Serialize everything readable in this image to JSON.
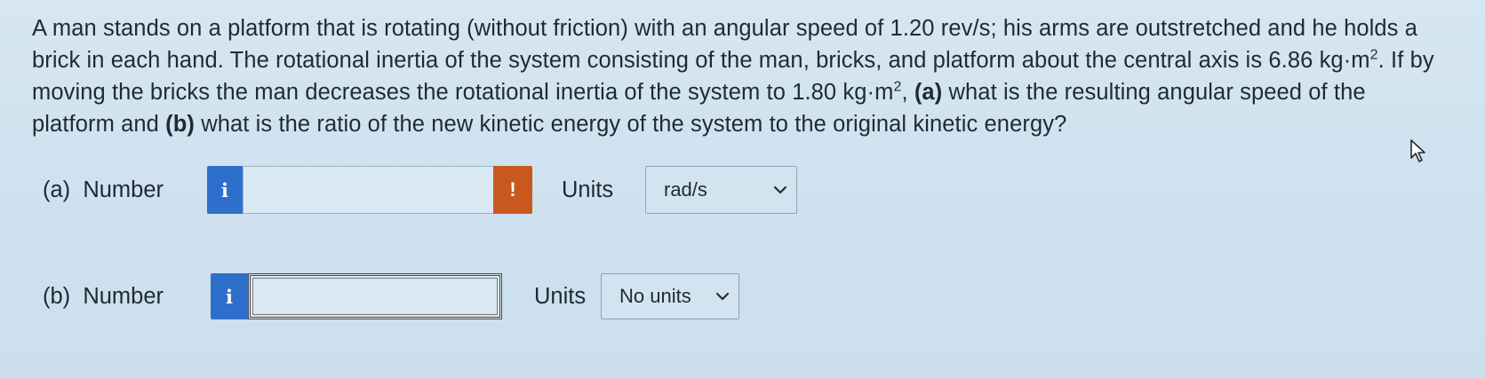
{
  "question": {
    "s1": "A man stands on a platform that is rotating (without friction) with an angular speed of 1.20 rev/s; his arms are outstretched and he holds a brick in each hand. The rotational inertia of the system consisting of the man, bricks, and platform about the central axis is 6.86 kg·m",
    "sup1": "2",
    "s2": ". If by moving the bricks the man decreases the rotational inertia of the system to 1.80 kg·m",
    "sup2": "2",
    "s3": ", ",
    "a_marker": "(a)",
    "s4": " what is the resulting angular speed of the platform and ",
    "b_marker": "(b)",
    "s5": " what is the ratio of the new kinetic energy of the system to the original kinetic energy?"
  },
  "part_a": {
    "label": "(a)  Number",
    "info_icon": "i",
    "value": "",
    "warning_icon": "!",
    "units_label": "Units",
    "units_selected": "rad/s"
  },
  "part_b": {
    "label": "(b)  Number",
    "info_icon": "i",
    "value": "",
    "units_label": "Units",
    "units_selected": "No units"
  },
  "colors": {
    "info_blue": "#2f6fcc",
    "warning_orange": "#c9581e",
    "background": "#d6e6f2"
  },
  "icons": {
    "info": "info-icon",
    "warning": "exclamation-icon",
    "dropdown": "chevron-down-icon",
    "cursor": "mouse-pointer-icon"
  }
}
